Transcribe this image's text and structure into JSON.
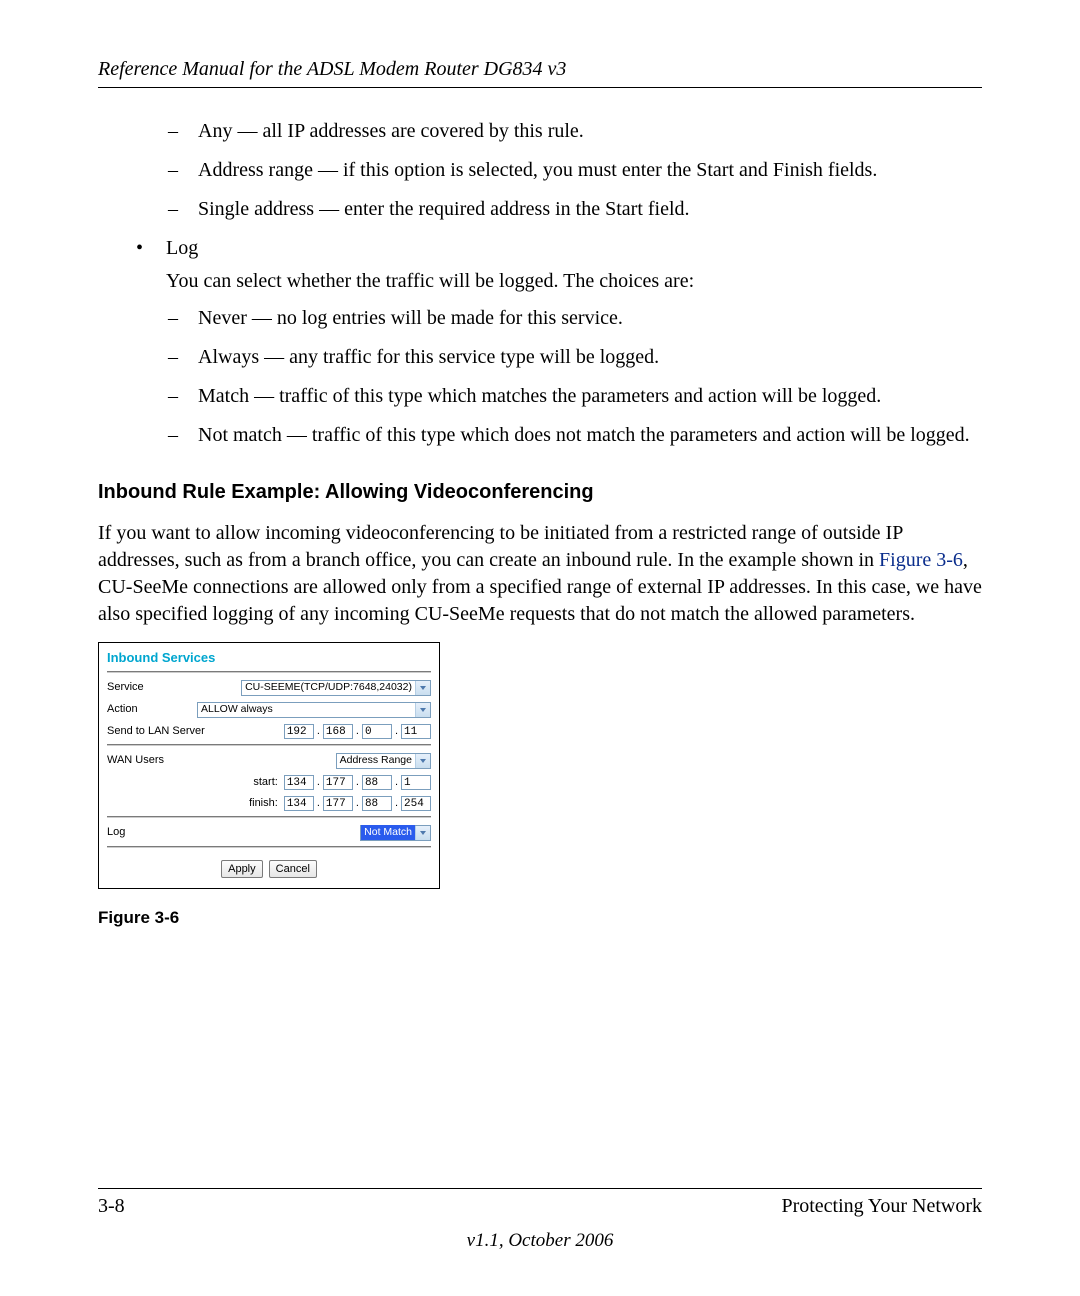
{
  "header": {
    "running_title": "Reference Manual for the ADSL Modem Router DG834 v3"
  },
  "list1": {
    "items": [
      "Any — all IP addresses are covered by this rule.",
      "Address range — if this option is selected, you must enter the Start and Finish fields.",
      "Single address — enter the required address in the Start field."
    ]
  },
  "log_bullet": {
    "title": "Log",
    "intro": "You can select whether the traffic will be logged. The choices are:",
    "items": [
      "Never — no log entries will be made for this service.",
      "Always — any traffic for this service type will be logged.",
      "Match — traffic of this type which matches the parameters and action will be logged.",
      "Not match — traffic of this type which does not match the parameters and action will be logged."
    ]
  },
  "section": {
    "heading": "Inbound Rule Example: Allowing Videoconferencing",
    "para_pre": "If you want to allow incoming videoconferencing to be initiated from a restricted range of outside IP addresses, such as from a branch office, you can create an inbound rule. In the example shown in ",
    "fig_ref": "Figure 3-6",
    "para_post": ", CU-SeeMe connections are allowed only from a specified range of external IP addresses. In this case, we have also specified logging of any incoming CU-SeeMe requests that do not match the allowed parameters."
  },
  "panel": {
    "title": "Inbound Services",
    "rows": {
      "service": {
        "label": "Service",
        "value": "CU-SEEME(TCP/UDP:7648,24032)"
      },
      "action": {
        "label": "Action",
        "value": "ALLOW always"
      },
      "send_to": {
        "label": "Send to LAN Server",
        "ip": [
          "192",
          "168",
          "0",
          "11"
        ]
      },
      "wan_users": {
        "label": "WAN Users",
        "value": "Address Range"
      },
      "start": {
        "label": "start:",
        "ip": [
          "134",
          "177",
          "88",
          "1"
        ]
      },
      "finish": {
        "label": "finish:",
        "ip": [
          "134",
          "177",
          "88",
          "254"
        ]
      },
      "log": {
        "label": "Log",
        "value": "Not Match"
      }
    },
    "buttons": {
      "apply": "Apply",
      "cancel": "Cancel"
    }
  },
  "figure_caption": "Figure 3-6",
  "footer": {
    "page": "3-8",
    "chapter": "Protecting Your Network",
    "version": "v1.1, October 2006"
  }
}
